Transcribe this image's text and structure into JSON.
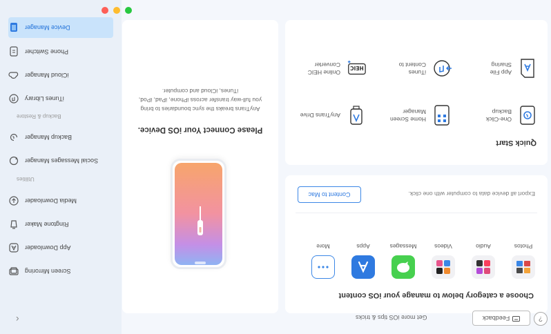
{
  "header": {
    "hint": "Get more iOS tips & tricks",
    "back_icon": "chevron-left-icon"
  },
  "sidebar": {
    "items_top": [
      {
        "label": "Screen Mirroring",
        "icon": "screen-mirroring-icon"
      },
      {
        "label": "App Downloader",
        "icon": "app-downloader-icon"
      },
      {
        "label": "Ringtone Maker",
        "icon": "ringtone-icon"
      },
      {
        "label": "Media Downloader",
        "icon": "media-download-icon"
      }
    ],
    "section_utilities": "Utilities",
    "items_mid": [
      {
        "label": "Social Messages Manager",
        "icon": "social-messages-icon"
      },
      {
        "label": "Backup Manager",
        "icon": "backup-icon"
      }
    ],
    "section_backup": "Backup & Restore",
    "items_bottom": [
      {
        "label": "iTunes Library",
        "icon": "itunes-icon"
      },
      {
        "label": "iCloud Manager",
        "icon": "icloud-icon"
      },
      {
        "label": "Phone Switcher",
        "icon": "phone-switcher-icon"
      },
      {
        "label": "Device Manager",
        "icon": "device-manager-icon",
        "active": true
      }
    ]
  },
  "device_panel": {
    "title": "Please Connect Your iOS Device.",
    "desc_line1": "AnyTrans breaks the sync boundaries to bring",
    "desc_line2": "you full-way transfer across iPhone, iPad, iPod,",
    "desc_line3": "iTunes, iCloud and computer."
  },
  "categories": {
    "title": "Choose a category below to manage your iOS content",
    "items": [
      {
        "label": "Photos",
        "icon": "photos-icon"
      },
      {
        "label": "Audio",
        "icon": "audio-icon"
      },
      {
        "label": "Videos",
        "icon": "videos-icon"
      },
      {
        "label": "Messages",
        "icon": "messages-icon"
      },
      {
        "label": "Apps",
        "icon": "apps-icon"
      },
      {
        "label": "More",
        "icon": "more-icon"
      }
    ],
    "export_desc": "Export all device data to computer with one click.",
    "content_to_mac": "Content to Mac"
  },
  "quick_start": {
    "title": "Quick Start",
    "items": [
      {
        "line1": "One-Click",
        "line2": "Backup",
        "icon": "one-click-backup-icon"
      },
      {
        "line1": "Home Screen",
        "line2": "Manager",
        "icon": "home-screen-icon"
      },
      {
        "line1": "AnyTrans Drive",
        "line2": "",
        "icon": "anytrans-drive-icon"
      },
      {
        "line1": "App File",
        "line2": "Sharing",
        "icon": "app-file-sharing-icon"
      },
      {
        "line1": "iTunes",
        "line2": "Content to",
        "icon": "itunes-content-icon"
      },
      {
        "line1": "Online HEIC",
        "line2": "Converter",
        "icon": "heic-converter-icon"
      }
    ]
  },
  "footer": {
    "feedback": "Feedback",
    "help": "?"
  },
  "colors": {
    "accent": "#2f7ae0",
    "active_bg": "#c9e3fb",
    "traffic_red": "#fe5f57",
    "traffic_yellow": "#febc2e",
    "traffic_green": "#28c840"
  }
}
